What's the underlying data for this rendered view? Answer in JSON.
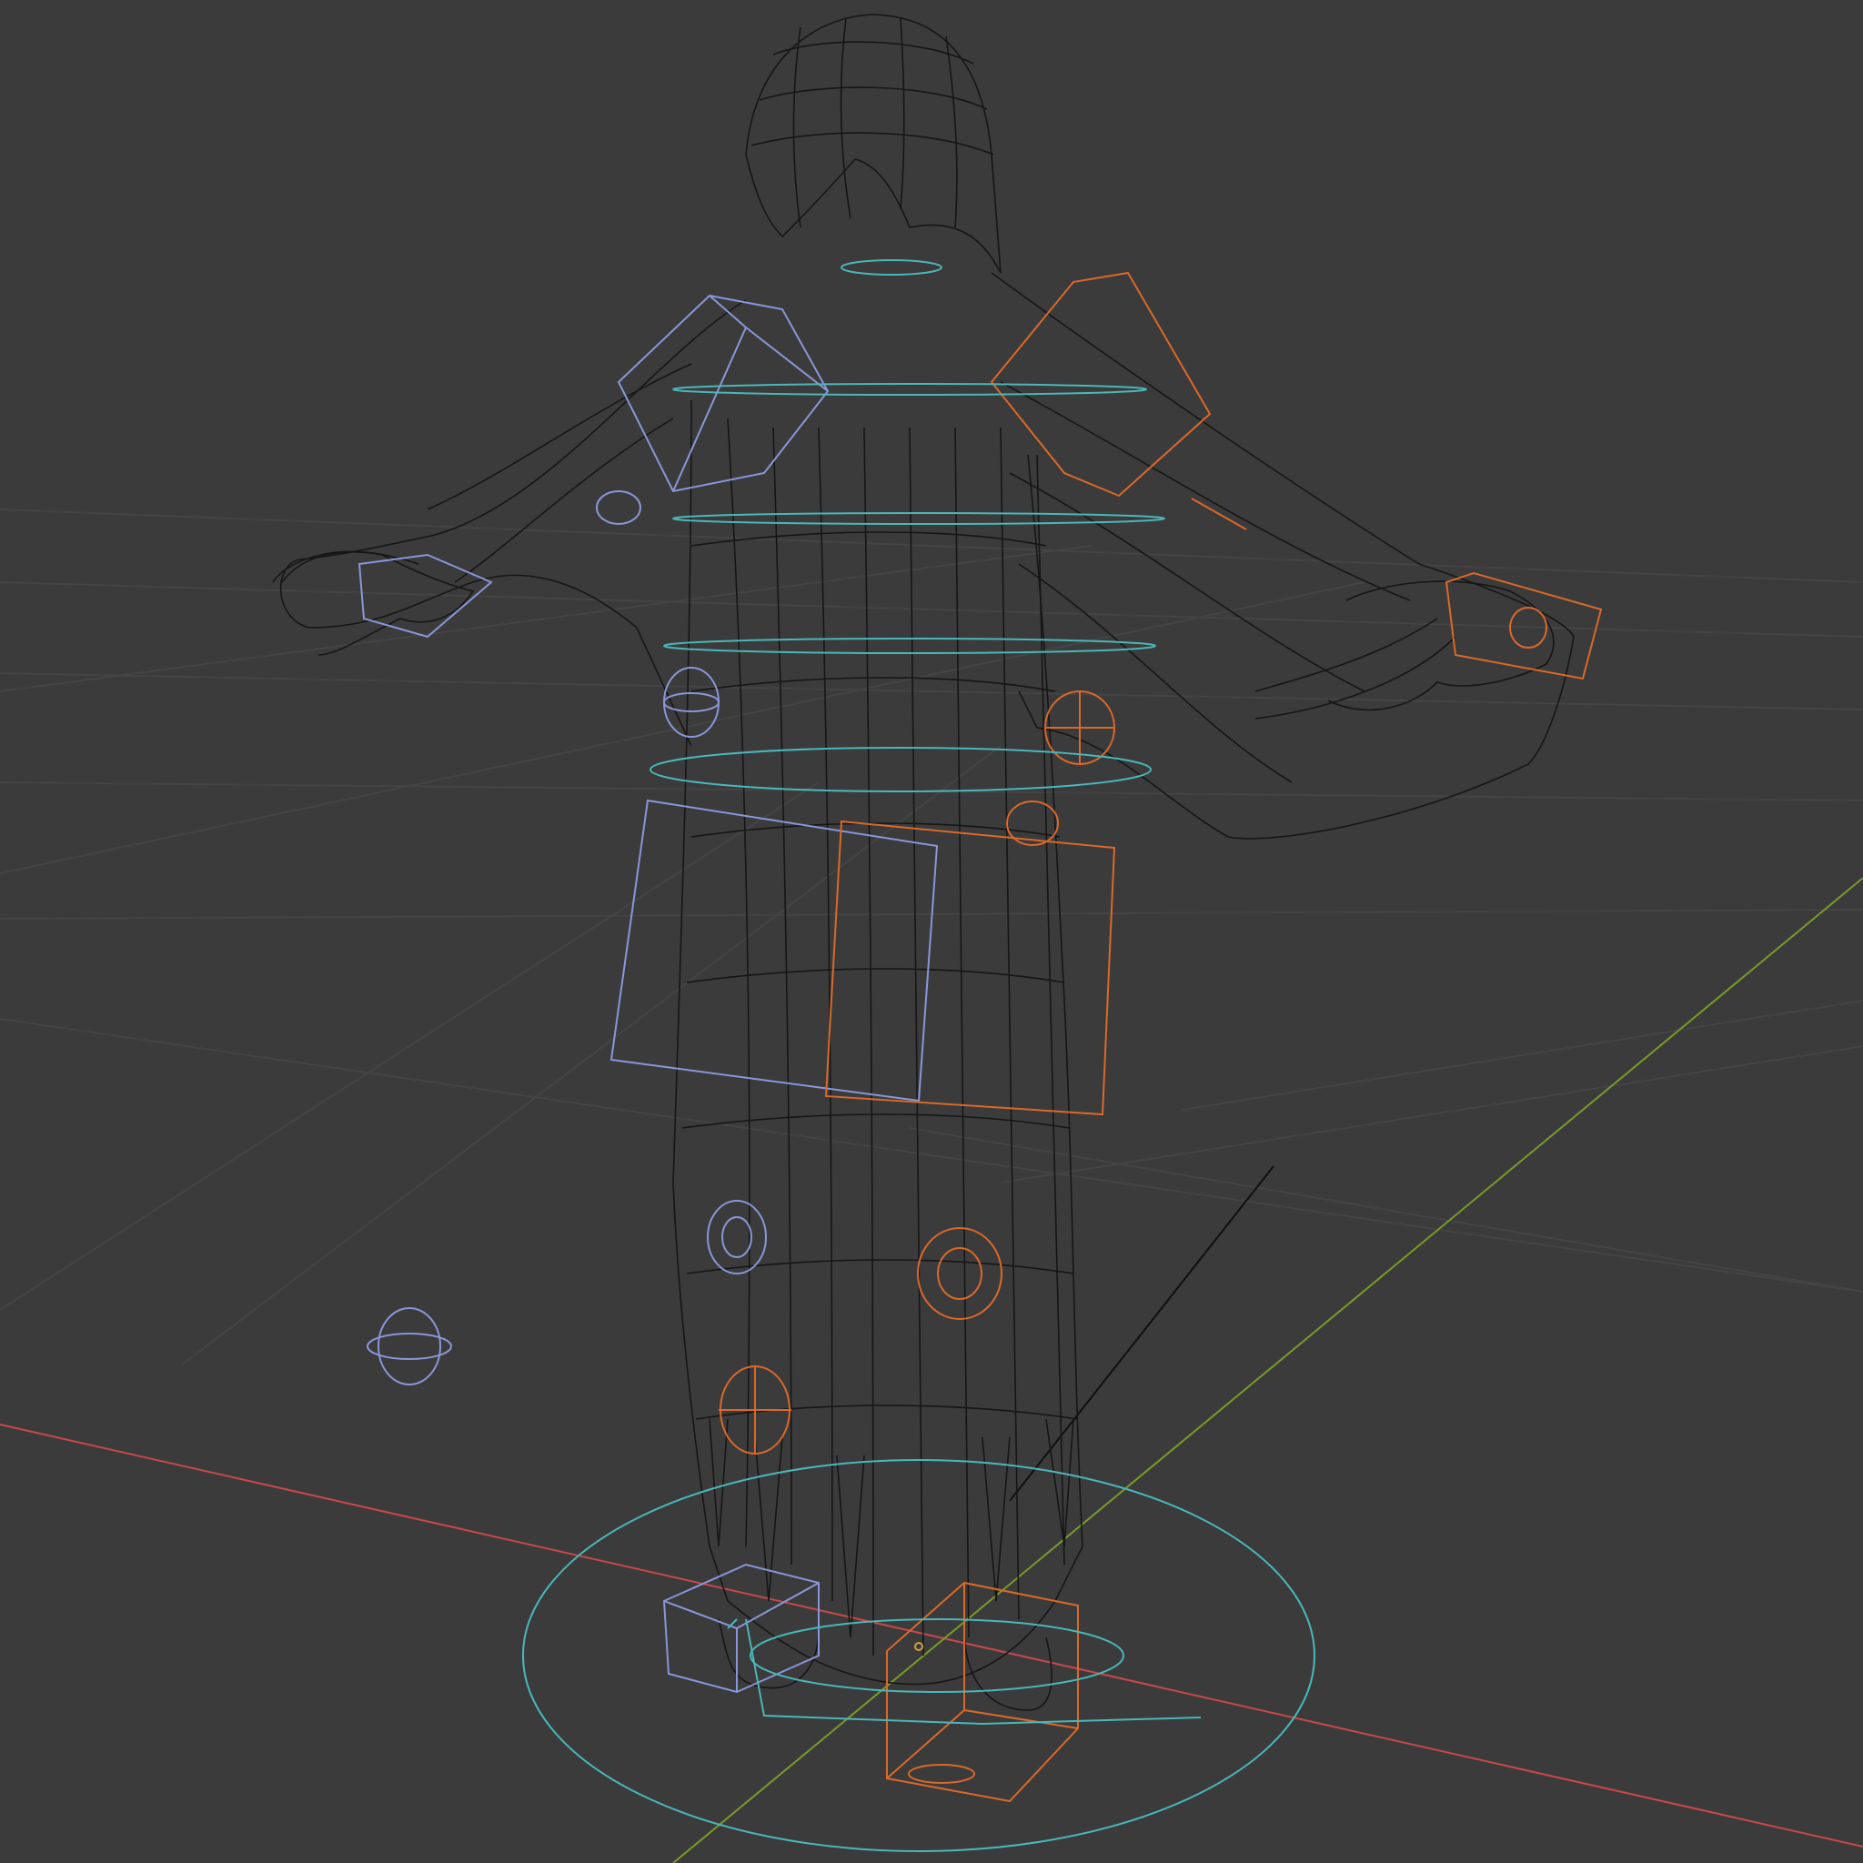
{
  "viewport": {
    "mode": "wireframe",
    "background_color": "#3b3b3b",
    "grid_color": "#444444",
    "mesh_color": "#161616",
    "axis_x_color": "#c8484c",
    "axis_y_color": "#7a9a2a",
    "rig_left_color": "#8a96d8",
    "rig_right_color": "#d9692a",
    "rig_center_color": "#4ab7b9"
  }
}
